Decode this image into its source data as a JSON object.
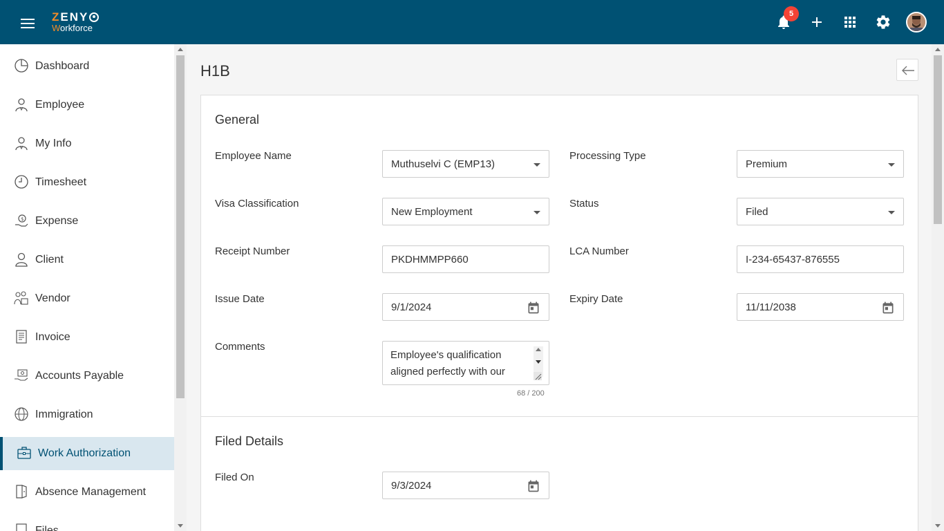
{
  "brand": {
    "name_prefix": "ZENY",
    "sub_prefix": "W",
    "sub_rest": "orkforce",
    "accent": "#f28c28",
    "primary": "#005173"
  },
  "header": {
    "notifications_count": "5",
    "icons": [
      "menu-icon",
      "bell-icon",
      "plus-icon",
      "apps-grid-icon",
      "gear-icon",
      "avatar"
    ]
  },
  "sidebar": {
    "items": [
      {
        "label": "Dashboard",
        "icon": "dashboard-icon"
      },
      {
        "label": "Employee",
        "icon": "employee-icon"
      },
      {
        "label": "My Info",
        "icon": "my-info-icon"
      },
      {
        "label": "Timesheet",
        "icon": "timesheet-icon"
      },
      {
        "label": "Expense",
        "icon": "expense-icon"
      },
      {
        "label": "Client",
        "icon": "client-icon"
      },
      {
        "label": "Vendor",
        "icon": "vendor-icon"
      },
      {
        "label": "Invoice",
        "icon": "invoice-icon"
      },
      {
        "label": "Accounts Payable",
        "icon": "accounts-payable-icon"
      },
      {
        "label": "Immigration",
        "icon": "immigration-icon"
      },
      {
        "label": "Work Authorization",
        "icon": "briefcase-icon",
        "active": true
      },
      {
        "label": "Absence Management",
        "icon": "absence-icon"
      },
      {
        "label": "Files",
        "icon": "files-icon"
      }
    ]
  },
  "page": {
    "title": "H1B"
  },
  "general": {
    "title": "General",
    "employee_name": {
      "label": "Employee Name",
      "value": "Muthuselvi C (EMP13)"
    },
    "processing_type": {
      "label": "Processing Type",
      "value": "Premium"
    },
    "visa_classification": {
      "label": "Visa Classification",
      "value": "New Employment"
    },
    "status": {
      "label": "Status",
      "value": "Filed"
    },
    "receipt_number": {
      "label": "Receipt Number",
      "value": "PKDHMMPP660"
    },
    "lca_number": {
      "label": "LCA Number",
      "value": "I-234-65437-876555"
    },
    "issue_date": {
      "label": "Issue Date",
      "value": "9/1/2024"
    },
    "expiry_date": {
      "label": "Expiry Date",
      "value": "11/11/2038"
    },
    "comments": {
      "label": "Comments",
      "value": "Employee's qualification aligned perfectly with our",
      "counter": "68 / 200"
    }
  },
  "filed_details": {
    "title": "Filed Details",
    "filed_on": {
      "label": "Filed On",
      "value": "9/3/2024"
    }
  }
}
